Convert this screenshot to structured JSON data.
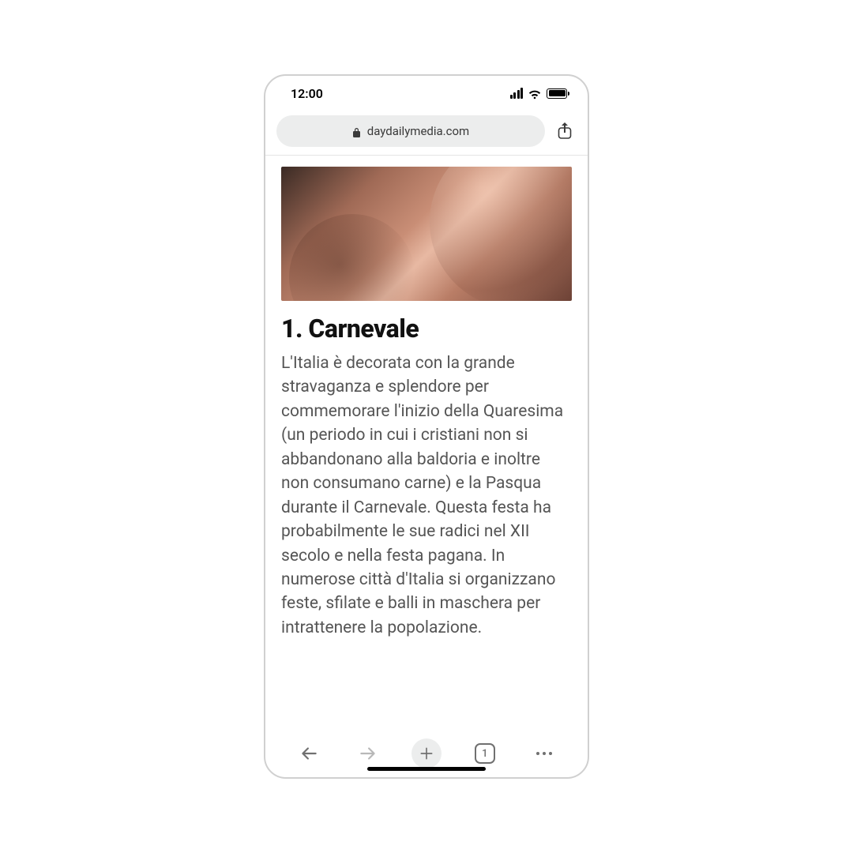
{
  "statusbar": {
    "time": "12:00"
  },
  "browser": {
    "url": "daydailymedia.com",
    "tab_count": "1"
  },
  "article": {
    "title": "1. Carnevale",
    "body": "L'Italia è decorata con la grande stravaganza e splendore per commemorare l'inizio della Quaresima (un periodo in cui i cristiani non si abbandonano alla baldoria e inoltre non consumano carne) e la Pasqua durante il Carnevale. Questa festa ha probabilmente le sue radici nel XII secolo e nella festa pagana. In numerose città d'Italia si organizzano feste, sfilate e balli in maschera per intrattenere la popolazione."
  }
}
